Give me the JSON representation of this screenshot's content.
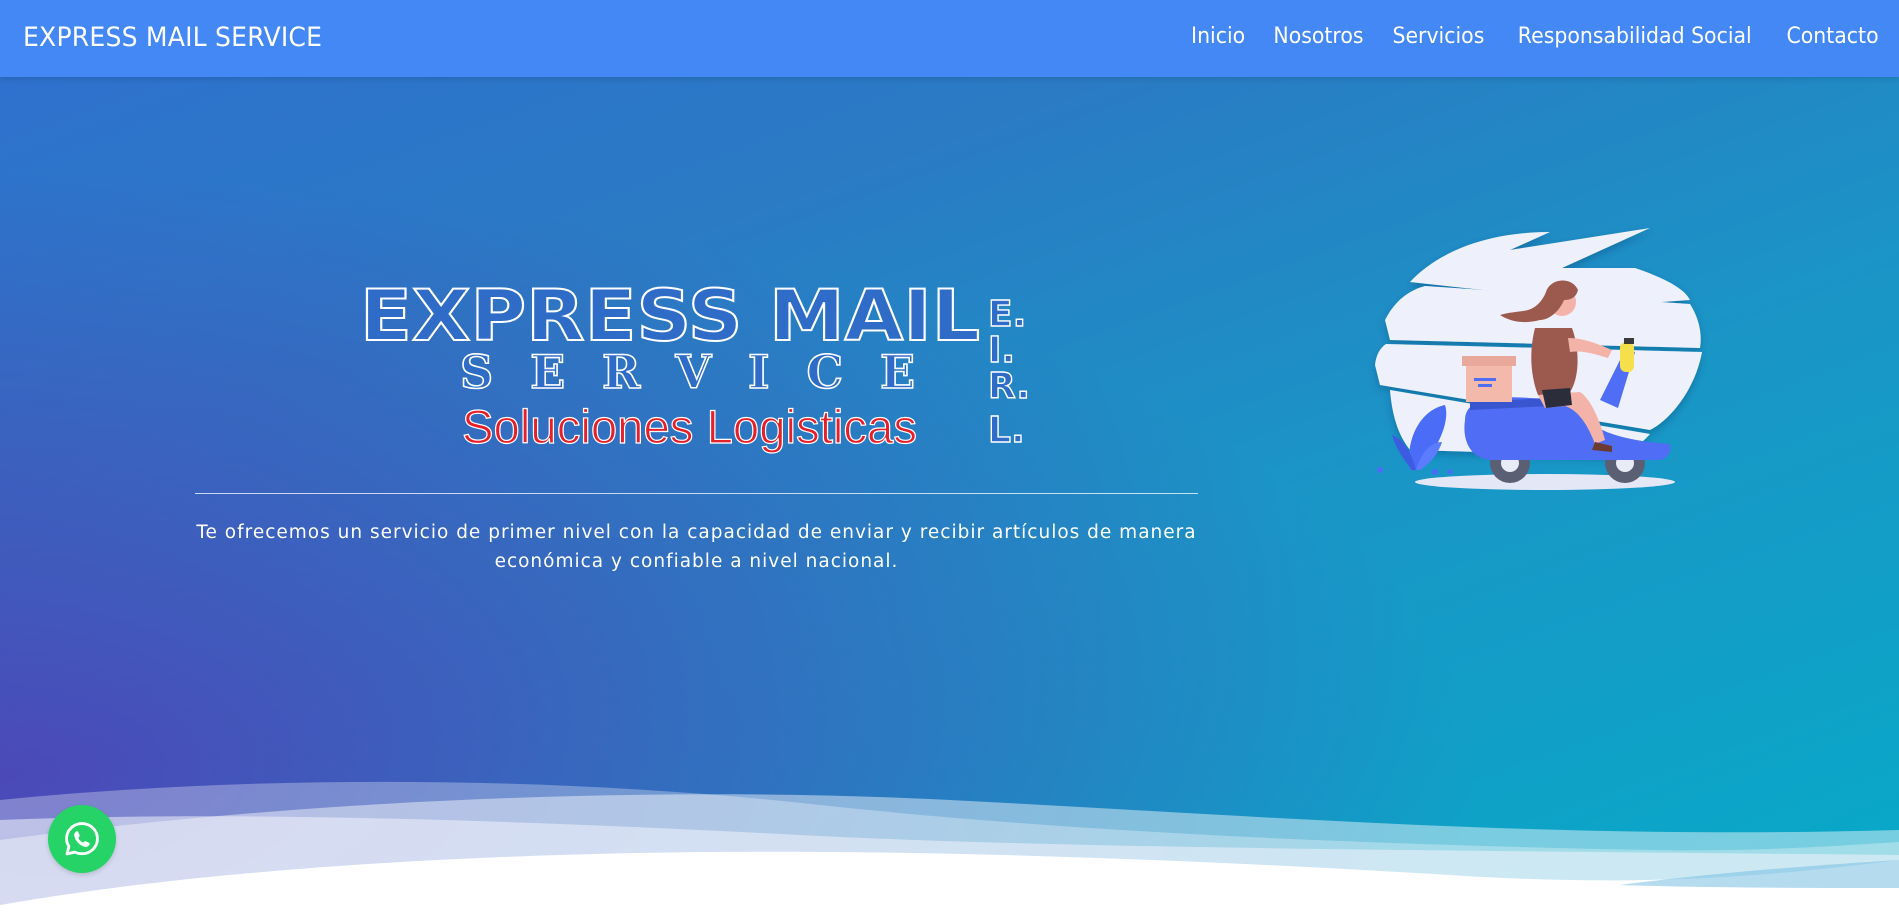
{
  "navbar": {
    "brand": "EXPRESS MAIL SERVICE",
    "links": [
      "Inicio",
      "Nosotros",
      "Servicios",
      "Responsabilidad Social",
      "Contacto"
    ]
  },
  "hero": {
    "logo": {
      "line1": "EXPRESS MAIL",
      "line2": "SERVICE",
      "tagline": "Soluciones Logisticas",
      "suffix": [
        "E.",
        "I.",
        "R.",
        "L."
      ]
    },
    "description_line1": "Te ofrecemos un servicio de primer nivel con la capacidad de enviar y recibir artículos de manera",
    "description_line2": "económica y confiable a nivel nacional."
  },
  "icons": {
    "whatsapp": "whatsapp-icon",
    "illustration": "delivery-scooter-illustration"
  },
  "colors": {
    "navbar": "#4388f4",
    "tagline_red": "#e5202a",
    "whatsapp_green": "#25d366"
  }
}
